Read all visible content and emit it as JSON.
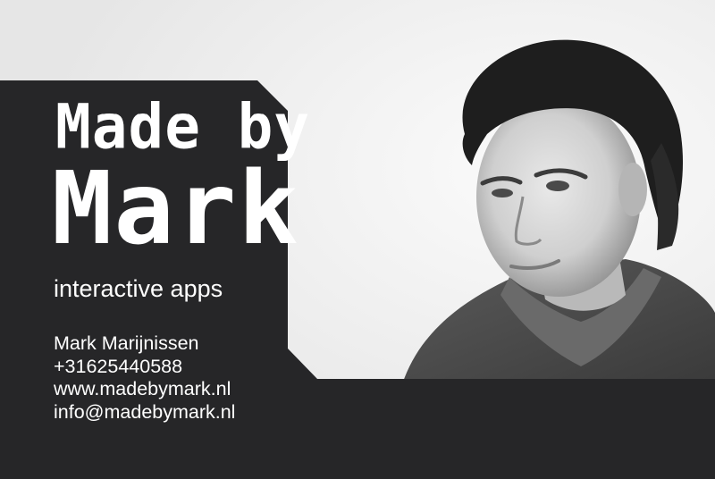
{
  "logo": {
    "line1": "Made by",
    "line2": "Mark"
  },
  "tagline": "interactive apps",
  "contact": {
    "name": "Mark Marijnissen",
    "phone": "+31625440588",
    "website": "www.madebymark.nl",
    "email": "info@madebymark.nl"
  },
  "colors": {
    "panel": "#262628",
    "text": "#ffffff",
    "background": "#f4f4f4"
  }
}
